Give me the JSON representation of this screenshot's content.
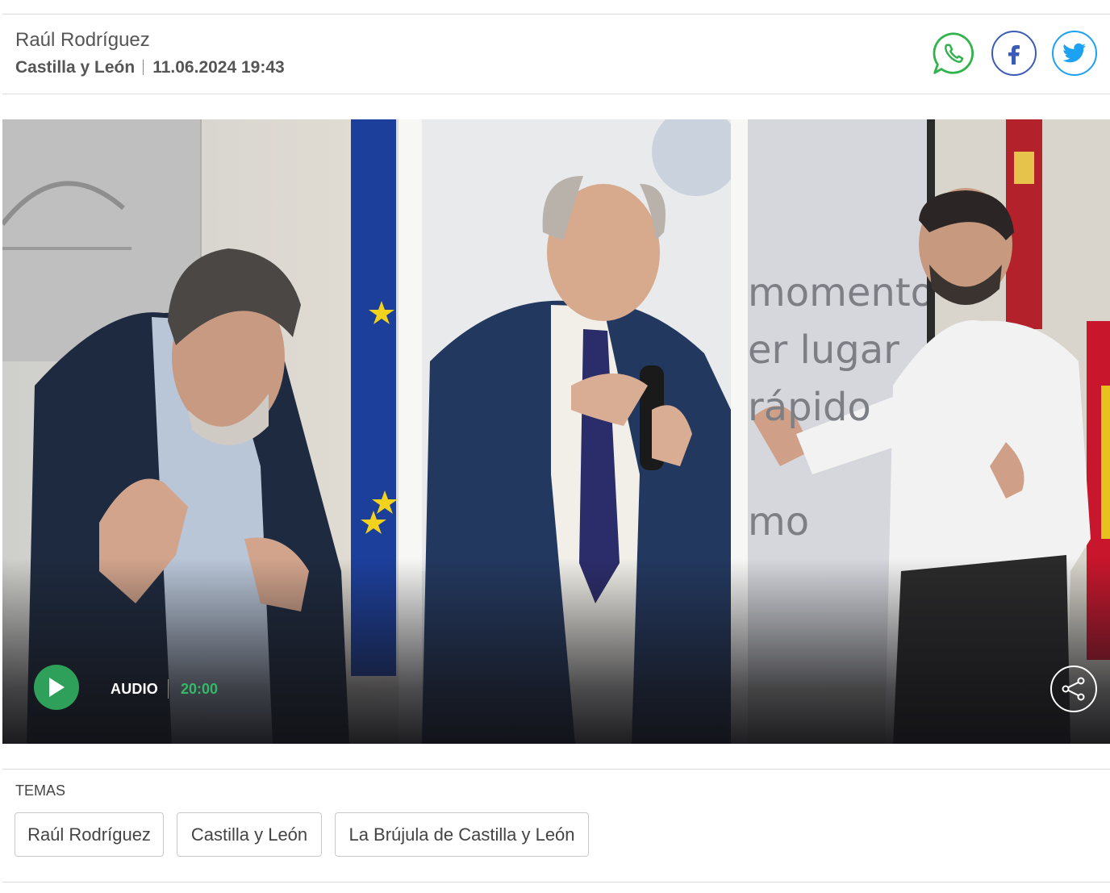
{
  "article": {
    "author": "Raúl Rodríguez",
    "region": "Castilla y León",
    "datetime": "11.06.2024 19:43"
  },
  "share": {
    "icons": [
      "whatsapp-icon",
      "facebook-icon",
      "twitter-icon"
    ],
    "colors": {
      "whatsapp": "#2fb34a",
      "facebook": "#3b5bb6",
      "twitter": "#1da1f2"
    }
  },
  "media": {
    "audio_label": "AUDIO",
    "duration": "20:00",
    "play_color": "#2ea05a",
    "duration_color": "#35b868",
    "slide_words": [
      "momento",
      "er lugar",
      "rápido",
      "mo"
    ]
  },
  "topics": {
    "title": "TEMAS",
    "tags": [
      "Raúl Rodríguez",
      "Castilla y León",
      "La Brújula de Castilla y León"
    ]
  }
}
